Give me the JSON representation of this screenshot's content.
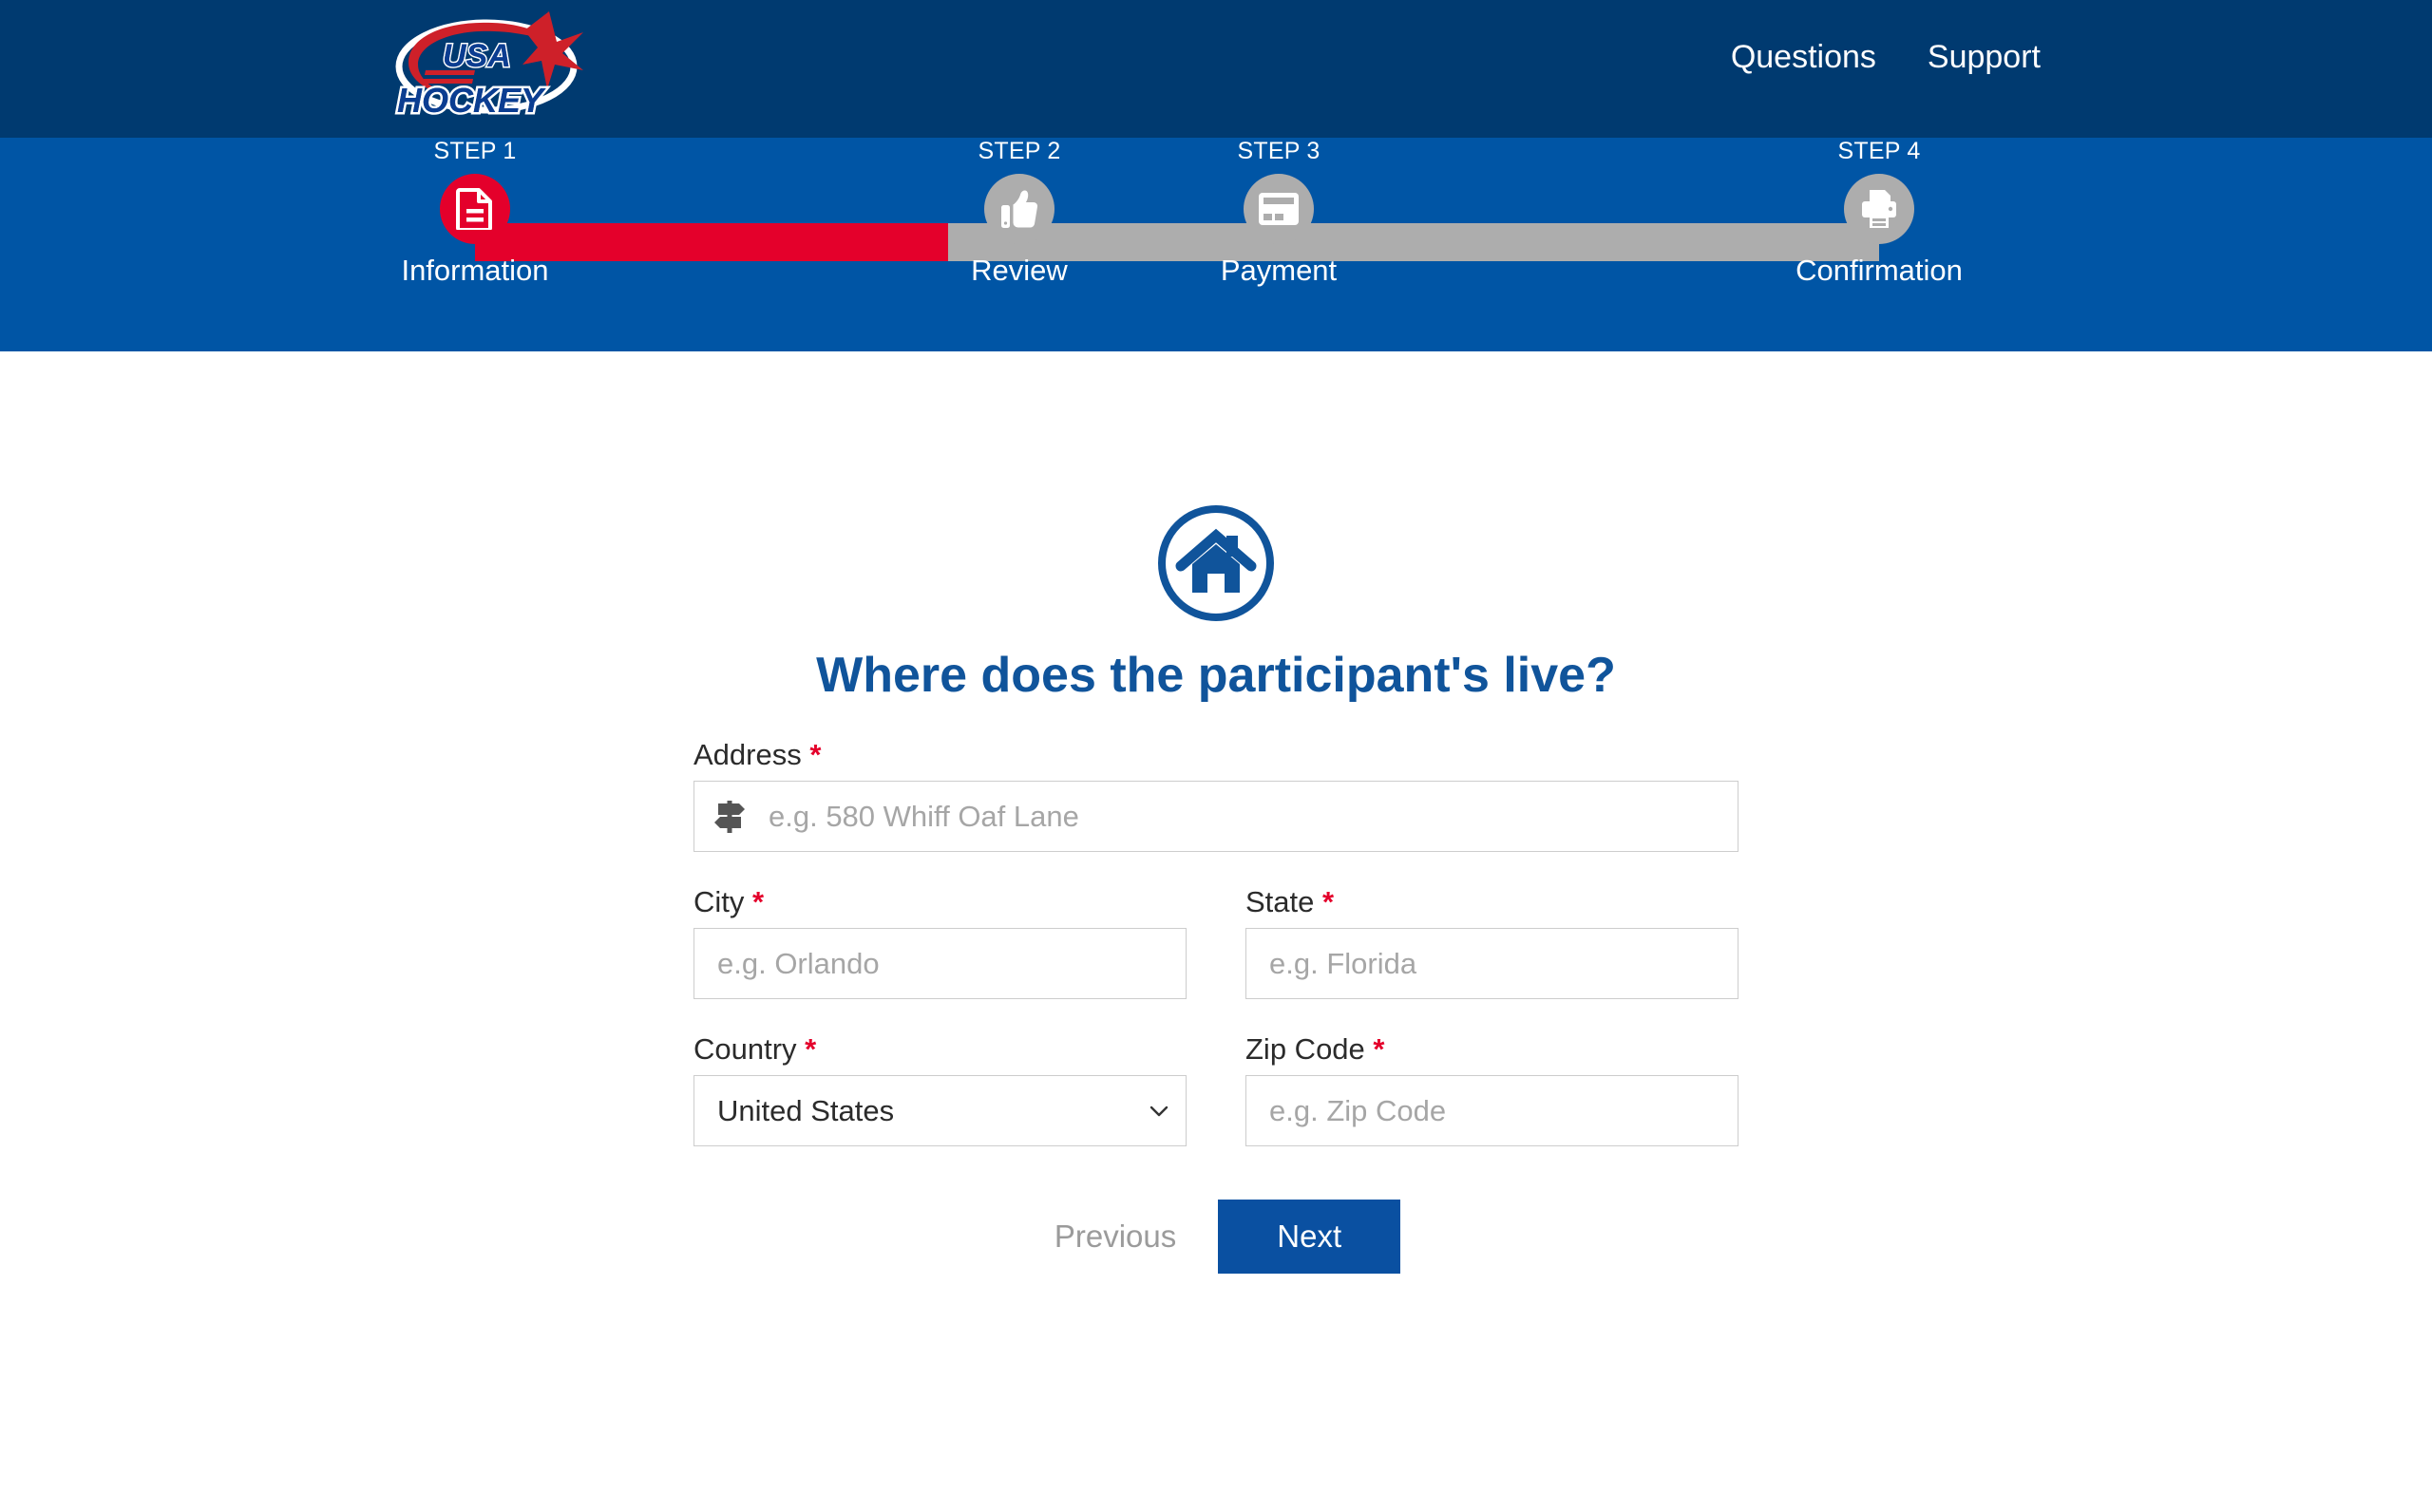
{
  "header": {
    "logo_alt": "USA Hockey",
    "logo_text_top": "USA",
    "logo_text_bottom": "HOCKEY",
    "nav": [
      {
        "label": "Questions",
        "name": "nav-link-questions"
      },
      {
        "label": "Support",
        "name": "nav-link-support"
      }
    ],
    "bg_color": "#003a70"
  },
  "progress": {
    "bg_color": "#0055a5",
    "track_color": "#adadad",
    "fill_color": "#e4002b",
    "fill_percent": 34,
    "steps": [
      {
        "num": "STEP 1",
        "label": "Information",
        "icon": "document-icon",
        "state": "active"
      },
      {
        "num": "STEP 2",
        "label": "Review",
        "icon": "thumbs-up-icon",
        "state": "inactive"
      },
      {
        "num": "STEP 3",
        "label": "Payment",
        "icon": "credit-card-icon",
        "state": "inactive"
      },
      {
        "num": "STEP 4",
        "label": "Confirmation",
        "icon": "printer-icon",
        "state": "inactive"
      }
    ]
  },
  "main": {
    "hero_icon": "home-circle-icon",
    "title": "Where does the participant's live?",
    "title_color": "#10549b",
    "required_marker": "*",
    "fields": {
      "address": {
        "label": "Address",
        "placeholder": "e.g. 580 Whiff Oaf Lane",
        "value": "",
        "icon": "signpost-icon",
        "required": true
      },
      "city": {
        "label": "City",
        "placeholder": "e.g. Orlando",
        "value": "",
        "required": true
      },
      "state": {
        "label": "State",
        "placeholder": "e.g. Florida",
        "value": "",
        "required": true
      },
      "country": {
        "label": "Country",
        "selected": "United States",
        "options": [
          "United States"
        ],
        "required": true
      },
      "zip": {
        "label": "Zip Code",
        "placeholder": "e.g. Zip Code",
        "value": "",
        "required": true
      }
    },
    "buttons": {
      "previous": "Previous",
      "next": "Next",
      "next_color": "#0a50a1"
    }
  }
}
